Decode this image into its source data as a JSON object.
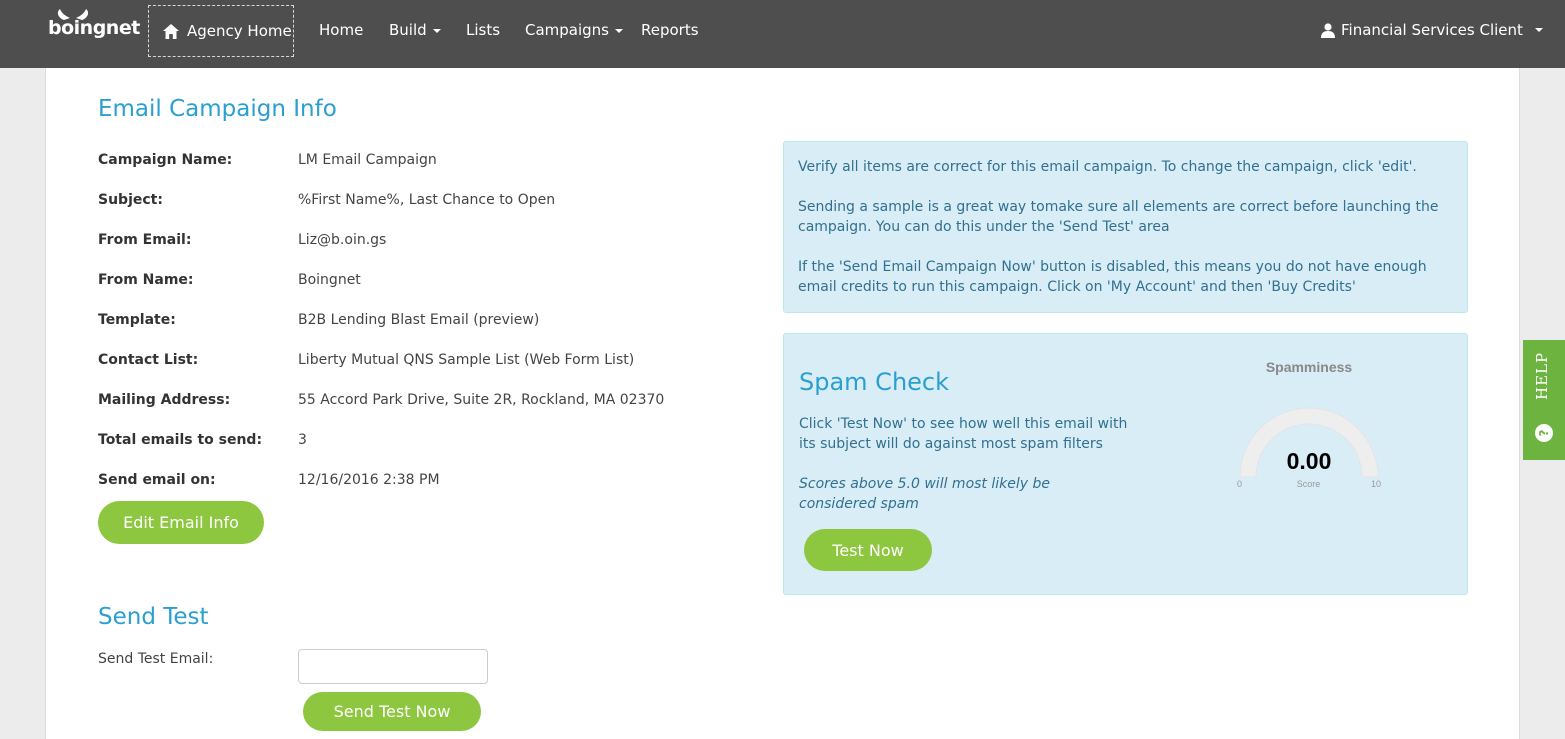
{
  "nav": {
    "logo_text": "boingnet",
    "agency_home": "Agency Home",
    "items": [
      {
        "label": "Home",
        "dropdown": false
      },
      {
        "label": "Build",
        "dropdown": true
      },
      {
        "label": "Lists",
        "dropdown": false
      },
      {
        "label": "Campaigns",
        "dropdown": true
      },
      {
        "label": "Reports",
        "dropdown": false
      }
    ],
    "user": "Financial Services Client"
  },
  "campaign_info": {
    "heading": "Email Campaign Info",
    "fields": [
      {
        "label": "Campaign Name:",
        "value": "LM Email Campaign"
      },
      {
        "label": "Subject:",
        "value": "%First Name%, Last Chance to Open"
      },
      {
        "label": "From Email:",
        "value": "Liz@b.oin.gs"
      },
      {
        "label": "From Name:",
        "value": "Boingnet"
      },
      {
        "label": "Template:",
        "value": "B2B Lending Blast Email (preview)"
      },
      {
        "label": "Contact List:",
        "value": "Liberty Mutual QNS Sample List (Web Form List)"
      },
      {
        "label": "Mailing Address:",
        "value": "55 Accord Park Drive, Suite 2R, Rockland, MA 02370"
      },
      {
        "label": "Total emails to send:",
        "value": "3"
      },
      {
        "label": "Send email on:",
        "value": "12/16/2016 2:38 PM"
      }
    ],
    "edit_button": "Edit Email Info"
  },
  "verify_box": {
    "paragraphs": [
      "Verify all items are correct for this email campaign. To change the campaign, click 'edit'.",
      "Sending a sample is a great way tomake sure all elements are correct before launching the campaign. You can do this under the 'Send Test' area",
      "If the 'Send Email Campaign Now' button is disabled, this means you do not have enough email credits to run this campaign. Click on 'My Account' and then 'Buy Credits'"
    ]
  },
  "spam_check": {
    "heading": "Spam Check",
    "description": "Click 'Test Now' to see how well this email with its subject will do against most spam filters",
    "note": "Scores above 5.0 will most likely be considered spam",
    "button": "Test Now",
    "gauge": {
      "title": "Spamminess",
      "value": "0.00",
      "score_label": "Score",
      "min": "0",
      "max": "10",
      "level": 0
    }
  },
  "send_test": {
    "heading": "Send Test",
    "label": "Send Test Email:",
    "input_value": "",
    "button": "Send Test Now"
  },
  "help_tab": {
    "label": "HELP"
  },
  "colors": {
    "navbar": "#4e4e4e",
    "accent_blue": "#2a9fd0",
    "button_green": "#8dc63f",
    "info_bg": "#d9edf7",
    "help_green": "#6cb43f"
  }
}
